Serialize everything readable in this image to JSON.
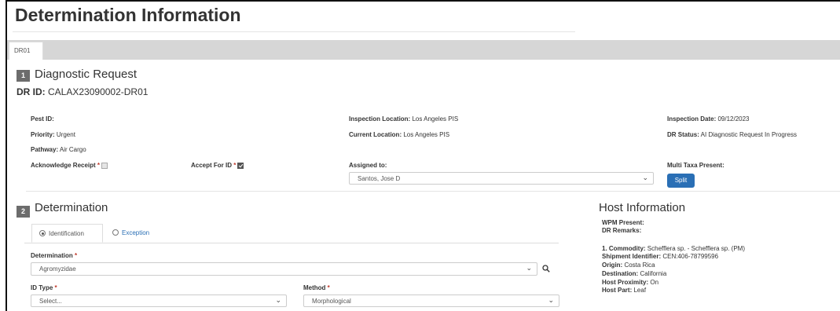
{
  "page": {
    "title": "Determination Information"
  },
  "tabs": [
    {
      "label": "DR01"
    }
  ],
  "diagnostic": {
    "badge": "1",
    "title": "Diagnostic Request",
    "dr_id_label": "DR ID:",
    "dr_id_value": "CALAX23090002-DR01",
    "pest_id_label": "Pest ID:",
    "pest_id_value": "",
    "priority_label": "Priority:",
    "priority_value": "Urgent",
    "pathway_label": "Pathway:",
    "pathway_value": "Air Cargo",
    "ack_label": "Acknowledge Receipt",
    "accept_label": "Accept For ID",
    "inspection_location_label": "Inspection Location:",
    "inspection_location_value": "Los Angeles PIS",
    "current_location_label": "Current Location:",
    "current_location_value": "Los Angeles PIS",
    "assigned_label": "Assigned to:",
    "assigned_value": "Santos, Jose D",
    "inspection_date_label": "Inspection Date:",
    "inspection_date_value": "09/12/2023",
    "dr_status_label": "DR Status:",
    "dr_status_value": "AI Diagnostic Request In Progress",
    "multi_taxa_label": "Multi Taxa Present:",
    "split_label": "Split"
  },
  "determination": {
    "badge": "2",
    "title": "Determination",
    "tab_identification": "Identification",
    "tab_exception": "Exception",
    "determination_label": "Determination",
    "determination_value": "Agromyzidae",
    "id_type_label": "ID Type",
    "id_type_value": "Select...",
    "method_label": "Method",
    "method_value": "Morphological",
    "required_mark": "*"
  },
  "host": {
    "title": "Host Information",
    "wpm_label": "WPM Present:",
    "dr_remarks_label": "DR Remarks:",
    "commodity_label": "1. Commodity:",
    "commodity_value": "Schefflera sp. - Schefflera sp. (PM)",
    "shipment_label": "Shipment Identifier:",
    "shipment_value": "CEN:406-78799596",
    "origin_label": "Origin:",
    "origin_value": "Costa Rica",
    "destination_label": "Destination:",
    "destination_value": "California",
    "proximity_label": "Host Proximity:",
    "proximity_value": "On",
    "part_label": "Host Part:",
    "part_value": "Leaf"
  },
  "colors": {
    "accent": "#2a6fb5",
    "badge": "#6c6c6c",
    "tabbar": "#d6d6d6"
  },
  "icons": {
    "search": "search-icon",
    "chevron": "chevron-down-icon"
  }
}
